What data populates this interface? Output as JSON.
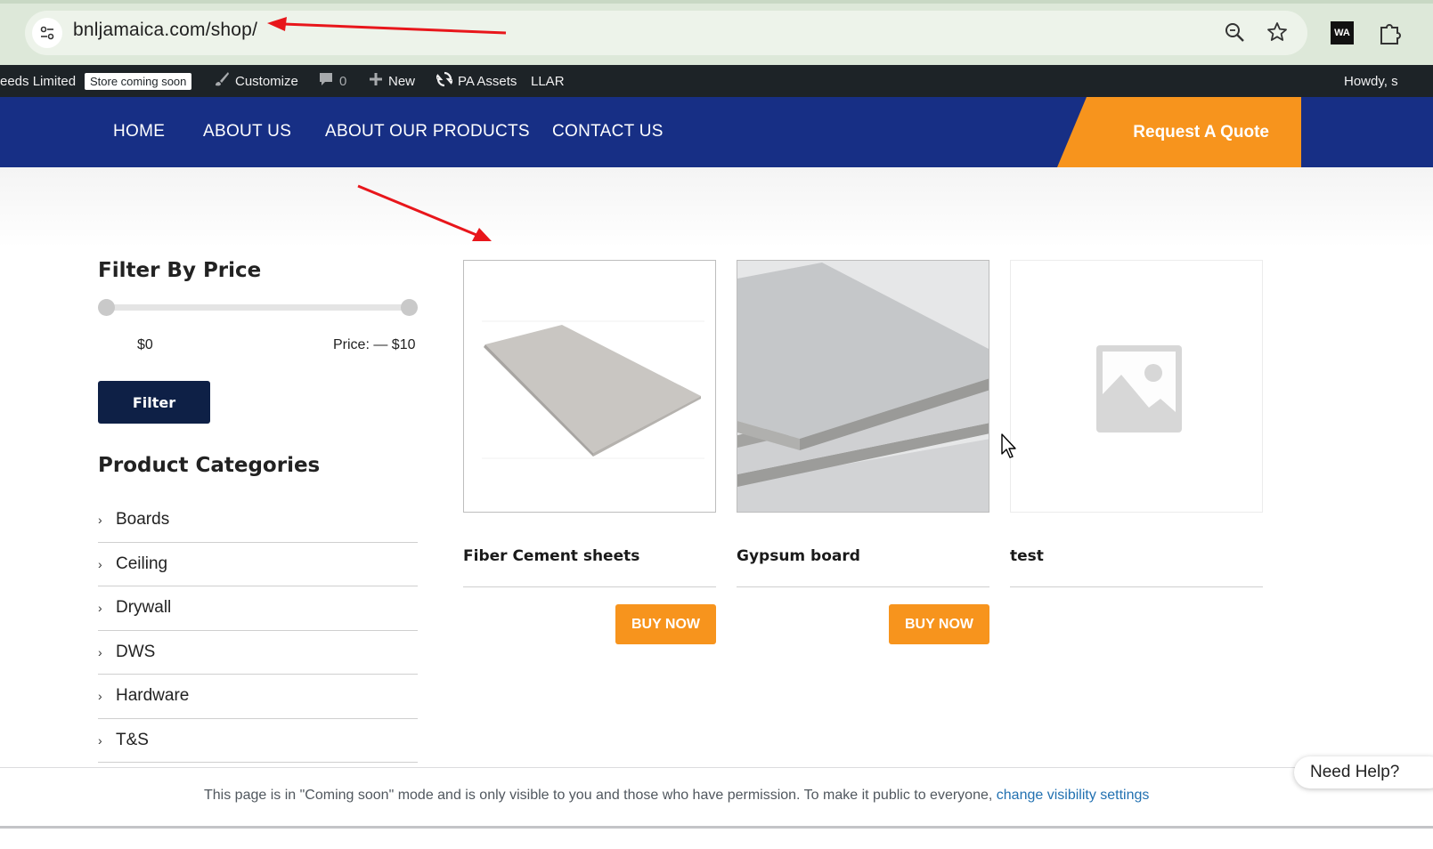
{
  "browser": {
    "url": "bnljamaica.com/shop/",
    "icons": [
      "site-info-icon",
      "zoom-icon",
      "bookmark-star-icon",
      "extensions-icon"
    ],
    "extension_label": "WA"
  },
  "adminbar": {
    "site_name": "eeds Limited",
    "badge": "Store coming soon",
    "customize": "Customize",
    "comments_count": "0",
    "new": "New",
    "pa_assets": "PA Assets",
    "llar": "LLAR",
    "howdy": "Howdy, s"
  },
  "nav": {
    "items": [
      "HOME",
      "ABOUT US",
      "ABOUT OUR PRODUCTS",
      "CONTACT US"
    ],
    "quote": "Request A Quote"
  },
  "colors": {
    "nav_bg": "#172f85",
    "accent": "#f7941d",
    "filter_btn": "#0e2046",
    "admin_bar": "#1d2327"
  },
  "sidebar": {
    "price_title": "Filter By Price",
    "price_min": "$0",
    "price_max": "Price: — $10",
    "filter_button": "Filter",
    "categories_title": "Product Categories",
    "categories": [
      "Boards",
      "Ceiling",
      "Drywall",
      "DWS",
      "Hardware",
      "T&S"
    ]
  },
  "products": [
    {
      "title": "Fiber Cement sheets",
      "button": "BUY NOW"
    },
    {
      "title": "Gypsum board",
      "button": "BUY NOW"
    },
    {
      "title": "test",
      "button": ""
    }
  ],
  "notice": {
    "text": "This page is in \"Coming soon\" mode and is only visible to you and those who have permission. To make it public to everyone, ",
    "link": "change visibility settings"
  },
  "help": "Need Help?"
}
